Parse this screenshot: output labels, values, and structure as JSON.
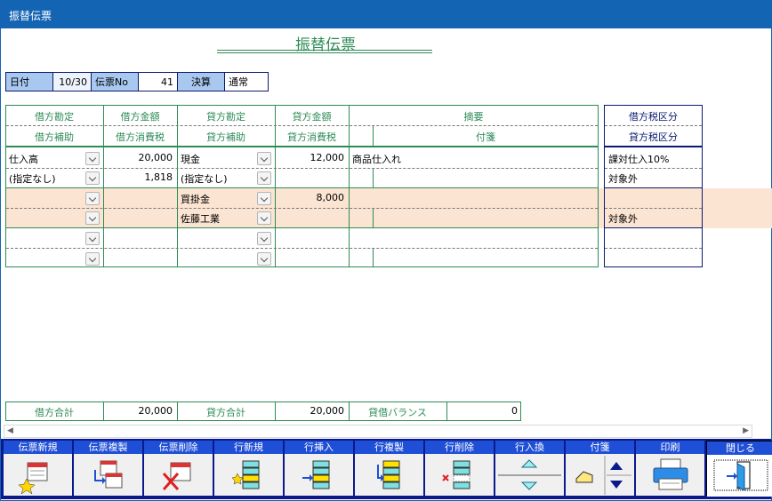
{
  "window": {
    "title": "振替伝票"
  },
  "page_title": "振替伝票",
  "header": {
    "date_label": "日付",
    "date_value": "10/30",
    "slip_no_label": "伝票No",
    "slip_no_value": "41",
    "settle_label": "決算",
    "settle_value": "通常"
  },
  "columns": {
    "debit_account": "借方勘定",
    "debit_amount": "借方金額",
    "credit_account": "貸方勘定",
    "credit_amount": "貸方金額",
    "memo": "摘要",
    "debit_sub": "借方補助",
    "debit_tax": "借方消費税",
    "credit_sub": "貸方補助",
    "credit_tax": "貸方消費税",
    "tag": "付箋",
    "debit_tax_class": "借方税区分",
    "credit_tax_class": "貸方税区分"
  },
  "rows": [
    {
      "debit_account": "仕入高",
      "debit_amount": "20,000",
      "credit_account": "現金",
      "credit_amount": "12,000",
      "memo": "商品仕入れ",
      "debit_sub": "(指定なし)",
      "debit_tax": "1,818",
      "credit_sub": "(指定なし)",
      "credit_tax": "",
      "tag": "",
      "debit_tax_class": "課対仕入10%",
      "credit_tax_class": "対象外"
    },
    {
      "debit_account": "",
      "debit_amount": "",
      "credit_account": "買掛金",
      "credit_amount": "8,000",
      "memo": "",
      "debit_sub": "",
      "debit_tax": "",
      "credit_sub": "佐藤工業",
      "credit_tax": "",
      "tag": "",
      "debit_tax_class": "",
      "credit_tax_class": "対象外"
    },
    {
      "debit_account": "",
      "debit_amount": "",
      "credit_account": "",
      "credit_amount": "",
      "memo": "",
      "debit_sub": "",
      "debit_tax": "",
      "credit_sub": "",
      "credit_tax": "",
      "tag": "",
      "debit_tax_class": "",
      "credit_tax_class": ""
    }
  ],
  "totals": {
    "debit_label": "借方合計",
    "debit_value": "20,000",
    "credit_label": "貸方合計",
    "credit_value": "20,000",
    "balance_label": "貸借バランス",
    "balance_value": "0"
  },
  "toolbar": [
    {
      "label": "伝票新規",
      "icon": "new-slip-icon"
    },
    {
      "label": "伝票複製",
      "icon": "copy-slip-icon"
    },
    {
      "label": "伝票削除",
      "icon": "delete-slip-icon"
    },
    {
      "label": "行新規",
      "icon": "new-row-icon"
    },
    {
      "label": "行挿入",
      "icon": "insert-row-icon"
    },
    {
      "label": "行複製",
      "icon": "copy-row-icon"
    },
    {
      "label": "行削除",
      "icon": "delete-row-icon"
    },
    {
      "label": "行入換",
      "icon": "swap-rows-icon"
    },
    {
      "label": "付箋",
      "icon": "sticky-tag-icon"
    },
    {
      "label": "印刷",
      "icon": "print-icon"
    },
    {
      "label": "閉じる",
      "icon": "close-door-icon"
    }
  ],
  "colors": {
    "titlebar": "#1464b4",
    "header_green": "#2e8b57",
    "label_blue": "#a8c8f0",
    "row_highlight": "#fce4d2",
    "toolbar_bg": "#0a1a8c",
    "toolbar_caption": "#1f4fd6"
  }
}
